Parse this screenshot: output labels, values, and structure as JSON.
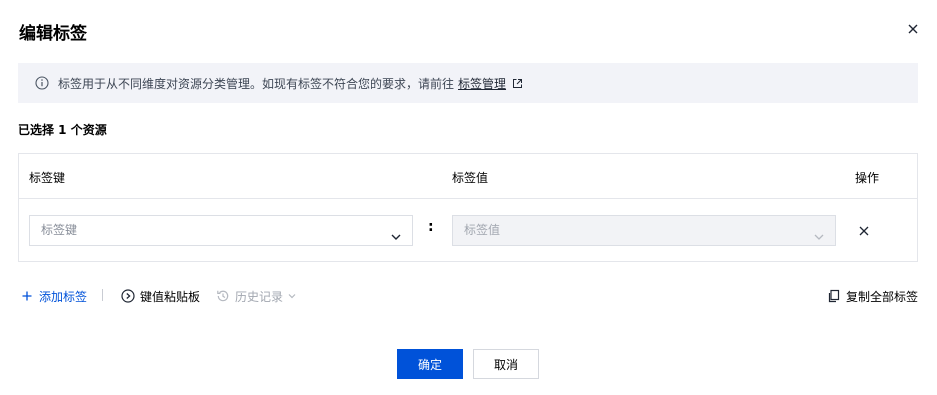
{
  "dialog": {
    "title": "编辑标签",
    "close_icon": "close-icon"
  },
  "notice": {
    "text": "标签用于从不同维度对资源分类管理。如现有标签不符合您的要求，请前往",
    "link_label": "标签管理",
    "info_icon": "info-circle-icon",
    "external_icon": "external-link-icon"
  },
  "selection": {
    "count_text": "已选择 1 个资源"
  },
  "table": {
    "headers": {
      "key": "标签键",
      "value": "标签值",
      "action": "操作"
    },
    "rows": [
      {
        "key_placeholder": "标签键",
        "separator": ":",
        "value_placeholder": "标签值",
        "value_disabled": true
      }
    ]
  },
  "toolbar": {
    "add_label": "添加标签",
    "clipboard_label": "键值粘贴板",
    "history_label": "历史记录",
    "copy_all_label": "复制全部标签"
  },
  "footer": {
    "ok_label": "确定",
    "cancel_label": "取消"
  },
  "colors": {
    "primary": "#0052d9",
    "notice_bg": "#f2f3f8",
    "border": "#e4e6eb",
    "disabled_text": "#a2a7b0"
  }
}
